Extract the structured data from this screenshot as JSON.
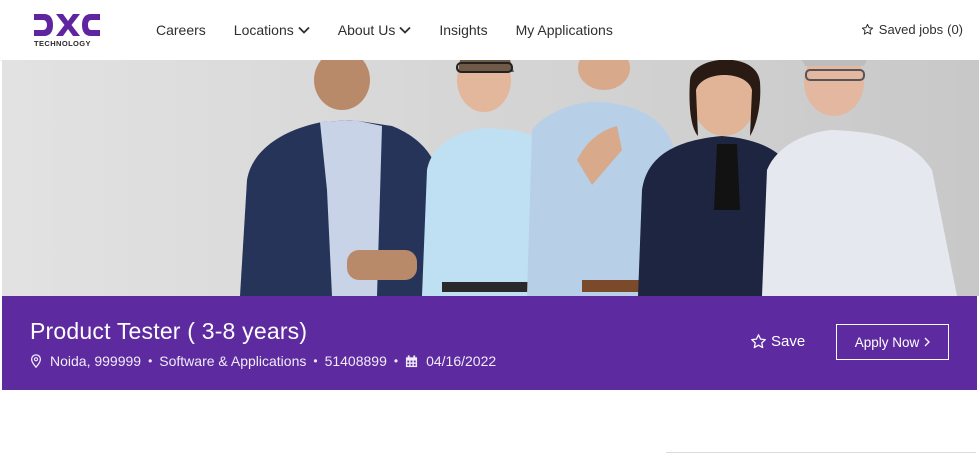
{
  "header": {
    "logo_text": "DXC",
    "logo_subtext": "TECHNOLOGY",
    "nav": [
      {
        "label": "Careers",
        "dropdown": false
      },
      {
        "label": "Locations",
        "dropdown": true
      },
      {
        "label": "About Us",
        "dropdown": true
      },
      {
        "label": "Insights",
        "dropdown": false
      },
      {
        "label": "My Applications",
        "dropdown": false
      }
    ],
    "saved_jobs_label": "Saved jobs",
    "saved_jobs_count": "(0)"
  },
  "job": {
    "title": "Product Tester ( 3-8 years)",
    "location": "Noida, 999999",
    "category": "Software & Applications",
    "job_id": "51408899",
    "date": "04/16/2022",
    "save_label": "Save",
    "apply_label": "Apply Now"
  },
  "colors": {
    "brand_purple": "#5d2aa0",
    "logo_purple": "#5f249f"
  },
  "icons": [
    "star-icon",
    "chevron-down-icon",
    "location-pin-icon",
    "calendar-icon",
    "chevron-right-icon"
  ]
}
